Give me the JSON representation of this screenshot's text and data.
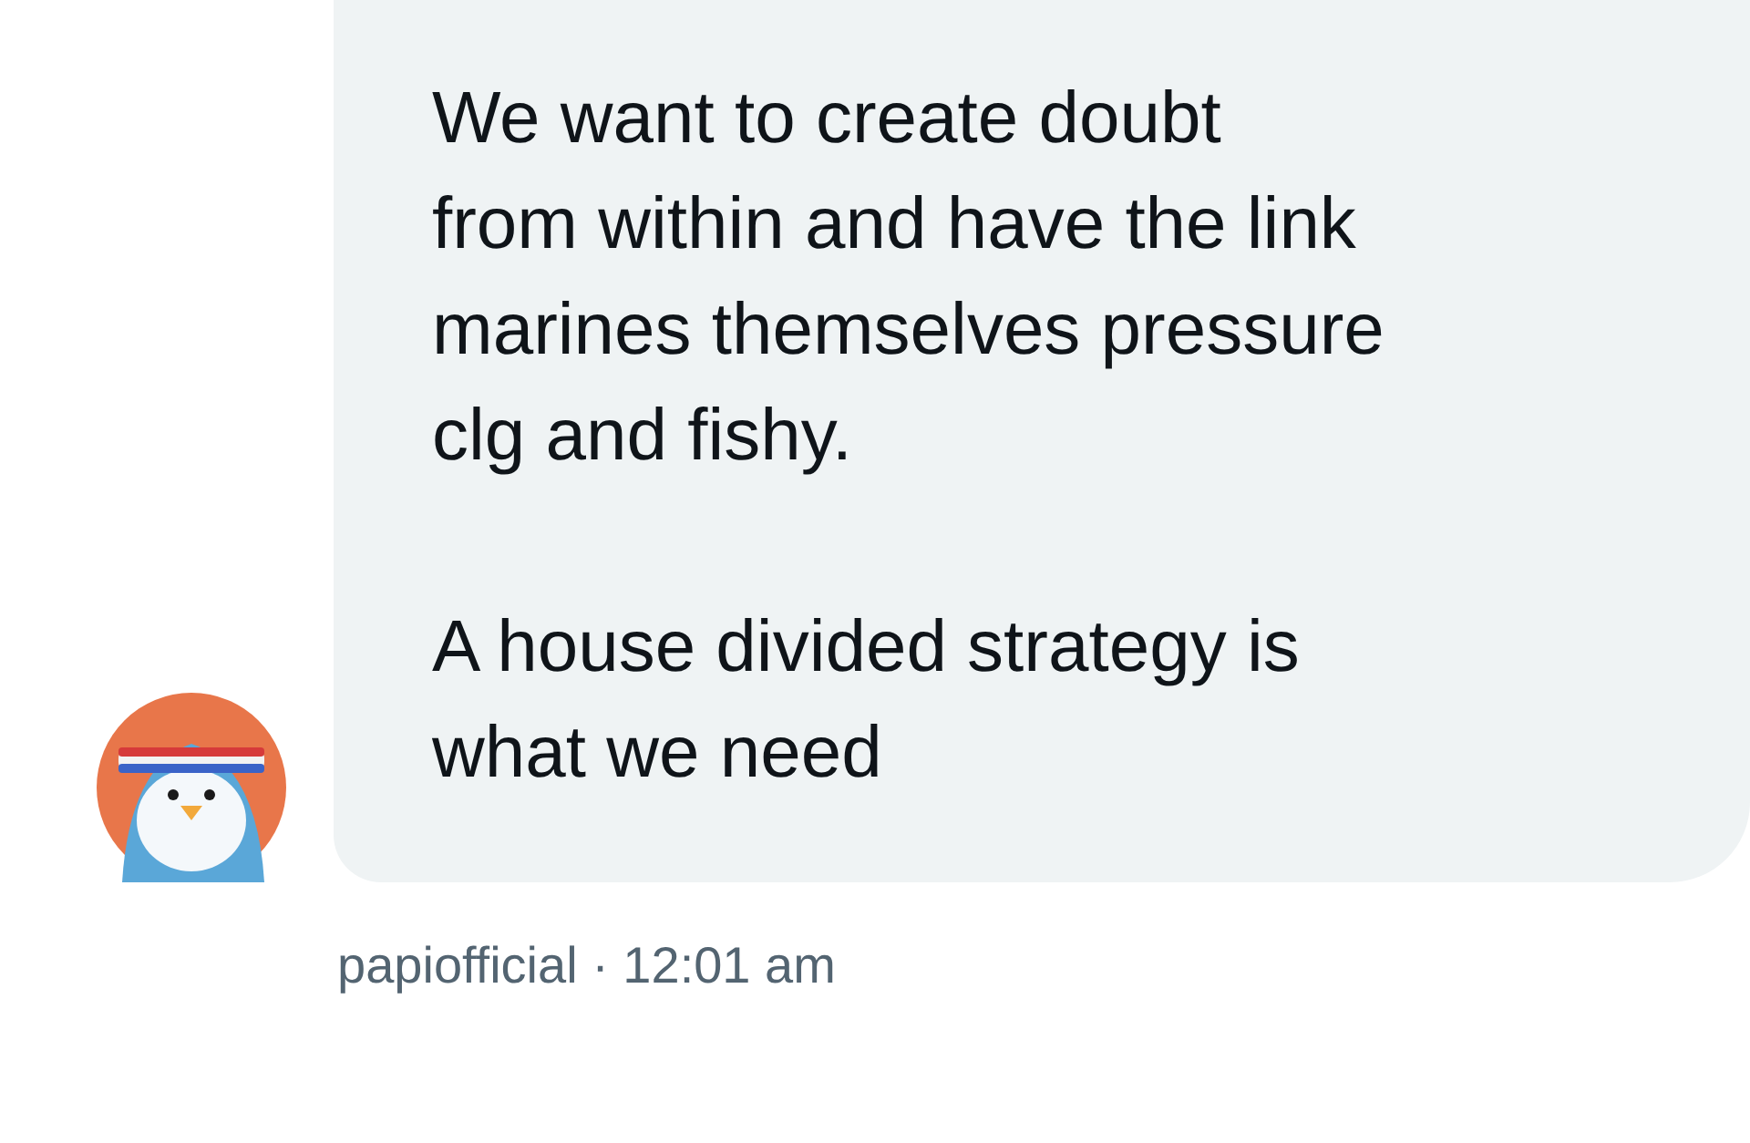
{
  "message": {
    "paragraphs": [
      [
        "We want to create doubt",
        "from within and have the link",
        "marines themselves pressure",
        "clg and fishy."
      ],
      [
        "A house divided strategy is",
        "what we need"
      ]
    ],
    "meta": "papiofficial · 12:01 am"
  }
}
